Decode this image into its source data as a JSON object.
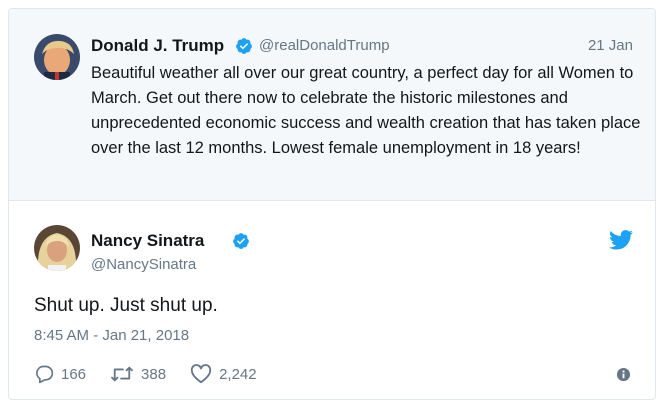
{
  "quoted_tweet": {
    "name": "Donald J. Trump",
    "handle": "@realDonaldTrump",
    "date": "21 Jan",
    "text": "Beautiful weather all over our great country, a perfect day for all Women to March. Get out there now to celebrate the historic milestones and unprecedented economic success and wealth creation that has taken place over the last 12 months. Lowest female unemployment in 18 years!",
    "avatar_icon": "user-avatar",
    "verified_icon": "verified-badge-icon"
  },
  "main_tweet": {
    "name": "Nancy Sinatra",
    "handle": "@NancySinatra",
    "text": "Shut up. Just shut up.",
    "timestamp": "8:45 AM - Jan 21, 2018",
    "avatar_icon": "user-avatar",
    "verified_icon": "verified-badge-icon",
    "brand_icon": "twitter-bird-icon"
  },
  "actions": {
    "replies": "166",
    "retweets": "388",
    "likes": "2,242"
  },
  "colors": {
    "accent": "#1da1f2",
    "muted": "#657786",
    "text": "#14171a",
    "quoted_bg": "#f5f8fa",
    "border": "#e1e8ed"
  }
}
